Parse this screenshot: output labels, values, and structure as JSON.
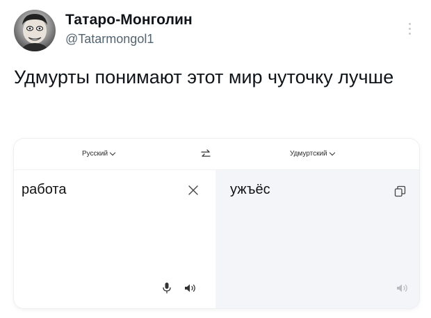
{
  "author": {
    "name": "Татаро-Монголин",
    "handle": "@Tatarmongol1"
  },
  "tweet": {
    "text": "Удмурты понимают этот мир чуточку лучше"
  },
  "translator": {
    "source_language": "Русский",
    "target_language": "Удмуртский",
    "source_text": "работа",
    "translated_text": "ужъёс"
  },
  "icons": {
    "avatar": "avatar-photo",
    "more": "more-vertical-icon",
    "swap": "swap-arrows-icon",
    "clear": "close-icon",
    "mic": "microphone-icon",
    "speaker": "speaker-icon",
    "copy": "copy-icon"
  },
  "colors": {
    "text": "#0f1419",
    "handle": "#536471",
    "target_pane": "#f4f5f8",
    "icon_dark": "#333333",
    "icon_light": "#b8bcc4"
  }
}
